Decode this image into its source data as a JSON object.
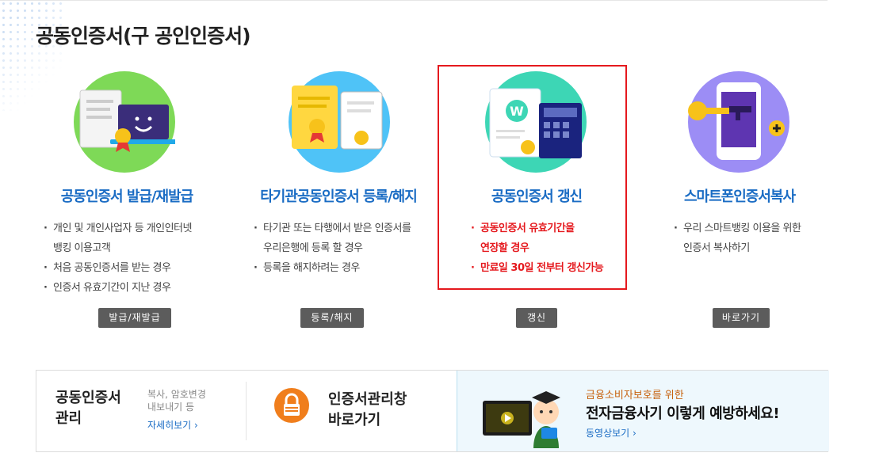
{
  "page_title": "공동인증서(구 공인인증서)",
  "cards": [
    {
      "title": "공동인증서 발급/재발급",
      "items": [
        {
          "line1": "개인 및 개인사업자 등 개인인터넷",
          "line2": "뱅킹 이용고객"
        },
        {
          "line1": "처음 공동인증서를 받는 경우",
          "line2": ""
        },
        {
          "line1": "인증서 유효기간이 지난 경우",
          "line2": ""
        }
      ],
      "button": "발급/재발급"
    },
    {
      "title": "타기관공동인증서 등록/해지",
      "items": [
        {
          "line1": "타기관 또는 타행에서 받은 인증서를",
          "line2": "우리은행에 등록 할 경우"
        },
        {
          "line1": "등록을 해지하려는 경우",
          "line2": ""
        }
      ],
      "button": "등록/해지"
    },
    {
      "title": "공동인증서 갱신",
      "items": [
        {
          "line1": "공동인증서 유효기간을",
          "line2": "연장할 경우"
        },
        {
          "line1": "만료일 30일 전부터 갱신가능",
          "line2": ""
        }
      ],
      "button": "갱신"
    },
    {
      "title": "스마트폰인증서복사",
      "items": [
        {
          "line1": "우리 스마트뱅킹 이용을 위한",
          "line2": "인증서 복사하기"
        }
      ],
      "button": "바로가기"
    }
  ],
  "bottom": {
    "manage_title_1": "공동인증서",
    "manage_title_2": "관리",
    "manage_desc_1": "복사, 암호변경",
    "manage_desc_2": "내보내기 등",
    "manage_link": "자세히보기",
    "window_title_1": "인증서관리창",
    "window_title_2": "바로가기",
    "promo_sub": "금융소비자보호를 위한",
    "promo_title": "전자금융사기 이렇게 예방하세요!",
    "promo_link": "동영상보기"
  },
  "colors": {
    "accent": "#1a6cc4",
    "highlight": "#e5191e",
    "button": "#5c5c5c",
    "lock": "#f07e1c",
    "promo_sub": "#c7620e"
  },
  "icons": [
    "certificate-laptop-icon",
    "certificate-register-icon",
    "certificate-renew-icon",
    "smartphone-copy-icon",
    "lock-icon",
    "video-promo-icon",
    "chevron-right-icon"
  ]
}
